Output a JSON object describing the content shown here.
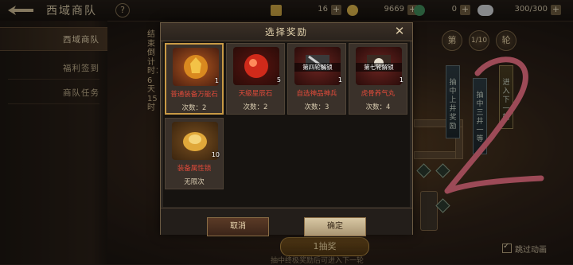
{
  "topbar": {
    "title": "西域商队",
    "help": "?",
    "resources": [
      {
        "icon": "ticket-icon",
        "value": "16",
        "plus": "+"
      },
      {
        "icon": "coin-icon",
        "value": "9669",
        "plus": "+"
      },
      {
        "icon": "jade-icon",
        "value": "0",
        "plus": "+"
      },
      {
        "icon": "silver-ingot-icon",
        "value": "300/300",
        "plus": "+"
      }
    ]
  },
  "sidebar": {
    "items": [
      {
        "label": "西域商队",
        "active": true
      },
      {
        "label": "福利签到",
        "active": false
      },
      {
        "label": "商队任务",
        "active": false
      }
    ]
  },
  "countdown_vertical": "结束倒计时：6天15时",
  "right_panel": {
    "round_prefix": "第",
    "round_value": "1/10",
    "round_suffix": "轮",
    "banners": [
      "抽中上井奖励",
      "抽中三井一等",
      "进入下一轮"
    ],
    "draw_button": "1抽奖",
    "hint": "抽中终极奖励后可进入下一轮",
    "skip_label": "跳过动画"
  },
  "annotation_number": "2",
  "modal": {
    "title": "选择奖励",
    "close": "✕",
    "items": [
      {
        "name": "普通装备万能石",
        "count": "1",
        "times": "次数：2",
        "icon": "amber-stone-icon",
        "selected": true,
        "overlay": ""
      },
      {
        "name": "天級星辰石",
        "count": "5",
        "times": "次数：2",
        "icon": "red-orb-icon",
        "selected": false,
        "overlay": ""
      },
      {
        "name": "自选神品神兵",
        "count": "1",
        "times": "次数：3",
        "icon": "weapon-chest-icon",
        "selected": false,
        "overlay": "第四轮解锁"
      },
      {
        "name": "虎骨养气丸",
        "count": "1",
        "times": "次数：4",
        "icon": "pill-chest-icon",
        "selected": false,
        "overlay": "第七轮解锁"
      },
      {
        "name": "装备属性锁",
        "count": "10",
        "times": "无限次",
        "icon": "gold-lock-icon",
        "selected": false,
        "overlay": ""
      }
    ],
    "cancel": "取消",
    "confirm": "确定"
  },
  "colors": {
    "accent_gold": "#c99a45",
    "item_name_red": "#e04a3a",
    "annotation_pink": "#f07286"
  }
}
